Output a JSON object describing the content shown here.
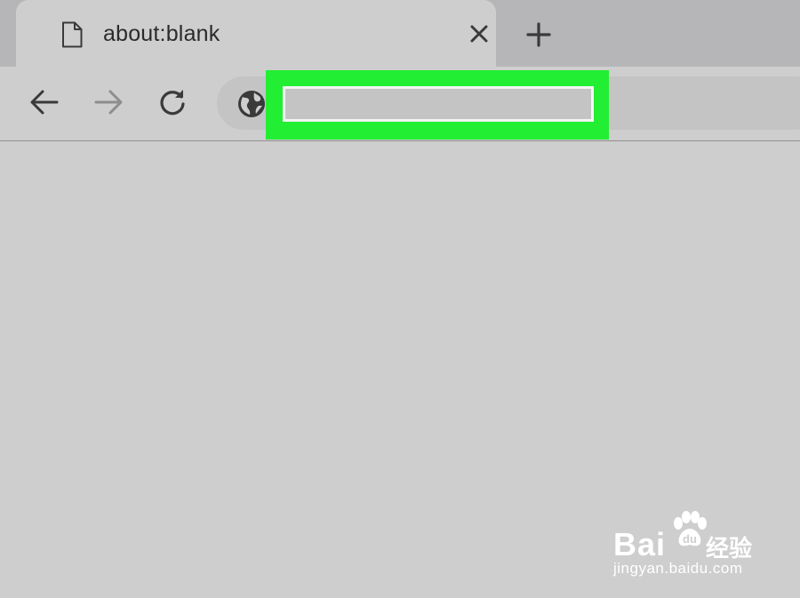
{
  "tab": {
    "title": "about:blank",
    "icon": "blank-page-icon",
    "close_icon": "close-icon"
  },
  "new_tab_icon": "plus-icon",
  "toolbar": {
    "back_icon": "arrow-left-icon",
    "forward_icon": "arrow-right-icon",
    "reload_icon": "reload-icon",
    "site_icon": "globe-icon"
  },
  "address_bar": {
    "value": "",
    "highlight_color": "#22ee33"
  },
  "watermark": {
    "brand": "Bai",
    "brand_suffix": "经验",
    "url": "jingyan.baidu.com"
  }
}
